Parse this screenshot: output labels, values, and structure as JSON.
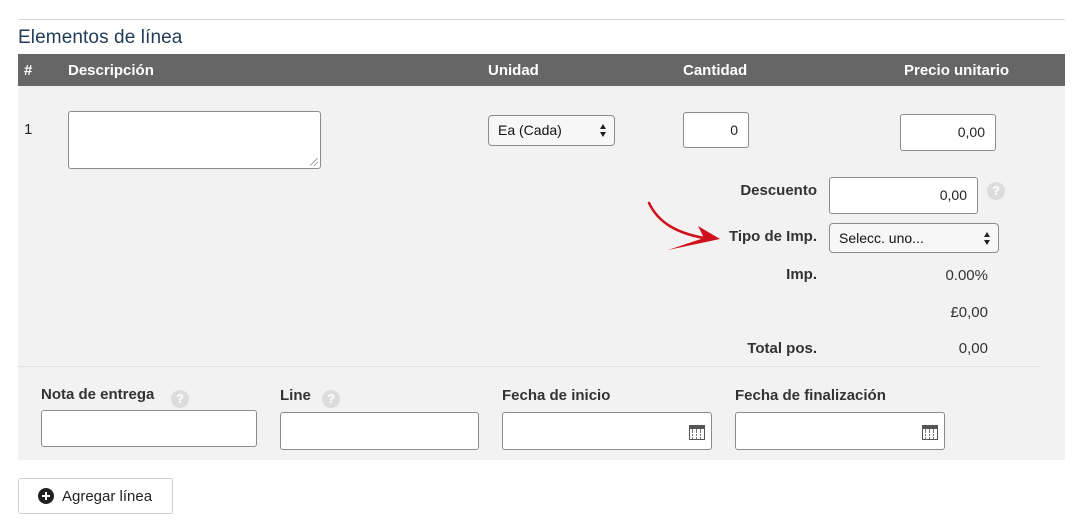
{
  "section_title": "Elementos de línea",
  "table_header": {
    "num": "#",
    "description": "Descripción",
    "unit": "Unidad",
    "quantity": "Cantidad",
    "unit_price": "Precio unitario"
  },
  "line_item": {
    "number": "1",
    "description_value": "",
    "unit_selected": "Ea (Cada)",
    "quantity_value": "0",
    "unit_price_value": "0,00",
    "discount_label": "Descuento",
    "discount_value": "0,00",
    "tax_type_label": "Tipo de Imp.",
    "tax_type_selected": "Selecc. uno...",
    "tax_label": "Imp.",
    "tax_rate": "0.00%",
    "tax_amount": "£0,00",
    "total_label": "Total pos.",
    "total_value": "0,00"
  },
  "delivery": {
    "note_label": "Nota de entrega",
    "line_label": "Line",
    "start_date_label": "Fecha de inicio",
    "end_date_label": "Fecha de finalización",
    "note_value": "",
    "line_value": "",
    "start_date_value": "",
    "end_date_value": ""
  },
  "add_line_button": "Agregar línea",
  "colors": {
    "header_bg": "#666666",
    "panel_bg": "#f2f2f2",
    "title": "#1f3b55",
    "arrow": "#d0101b"
  },
  "icons": [
    "help-icon",
    "calendar-icon",
    "plus-circle-icon",
    "select-arrows-icon",
    "red-arrow-annotation"
  ]
}
